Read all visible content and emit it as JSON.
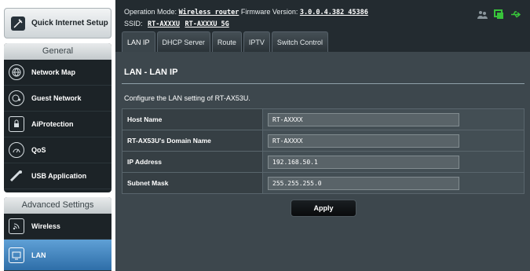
{
  "sidebar": {
    "quick_setup_label": "Quick Internet Setup",
    "general_header": "General",
    "general_items": [
      {
        "label": "Network Map"
      },
      {
        "label": "Guest Network"
      },
      {
        "label": "AiProtection"
      },
      {
        "label": "QoS"
      },
      {
        "label": "USB Application"
      }
    ],
    "advanced_header": "Advanced Settings",
    "advanced_items": [
      {
        "label": "Wireless"
      },
      {
        "label": "LAN"
      }
    ]
  },
  "header": {
    "operation_mode_label": "Operation Mode:",
    "operation_mode_value": "Wireless router",
    "firmware_label": "Firmware Version:",
    "firmware_value": "3.0.0.4.382_45386",
    "ssid_label": "SSID:",
    "ssid_1": "RT-AXXXU",
    "ssid_2": "RT-AXXXU_5G"
  },
  "tabs": [
    {
      "label": "LAN IP",
      "active": true
    },
    {
      "label": "DHCP Server"
    },
    {
      "label": "Route"
    },
    {
      "label": "IPTV"
    },
    {
      "label": "Switch Control"
    }
  ],
  "main": {
    "title": "LAN - LAN IP",
    "description": "Configure the LAN setting of RT-AX53U.",
    "fields": [
      {
        "label": "Host Name",
        "value": "RT-AXXXX"
      },
      {
        "label": "RT-AX53U's Domain Name",
        "value": "RT-AXXXX"
      },
      {
        "label": "IP Address",
        "value": "192.168.50.1"
      },
      {
        "label": "Subnet Mask",
        "value": "255.255.255.0"
      }
    ],
    "apply_label": "Apply"
  },
  "colors": {
    "active_menu": "#3f88c5",
    "status_green": "#38c33a",
    "content_bg": "#3d474d"
  }
}
